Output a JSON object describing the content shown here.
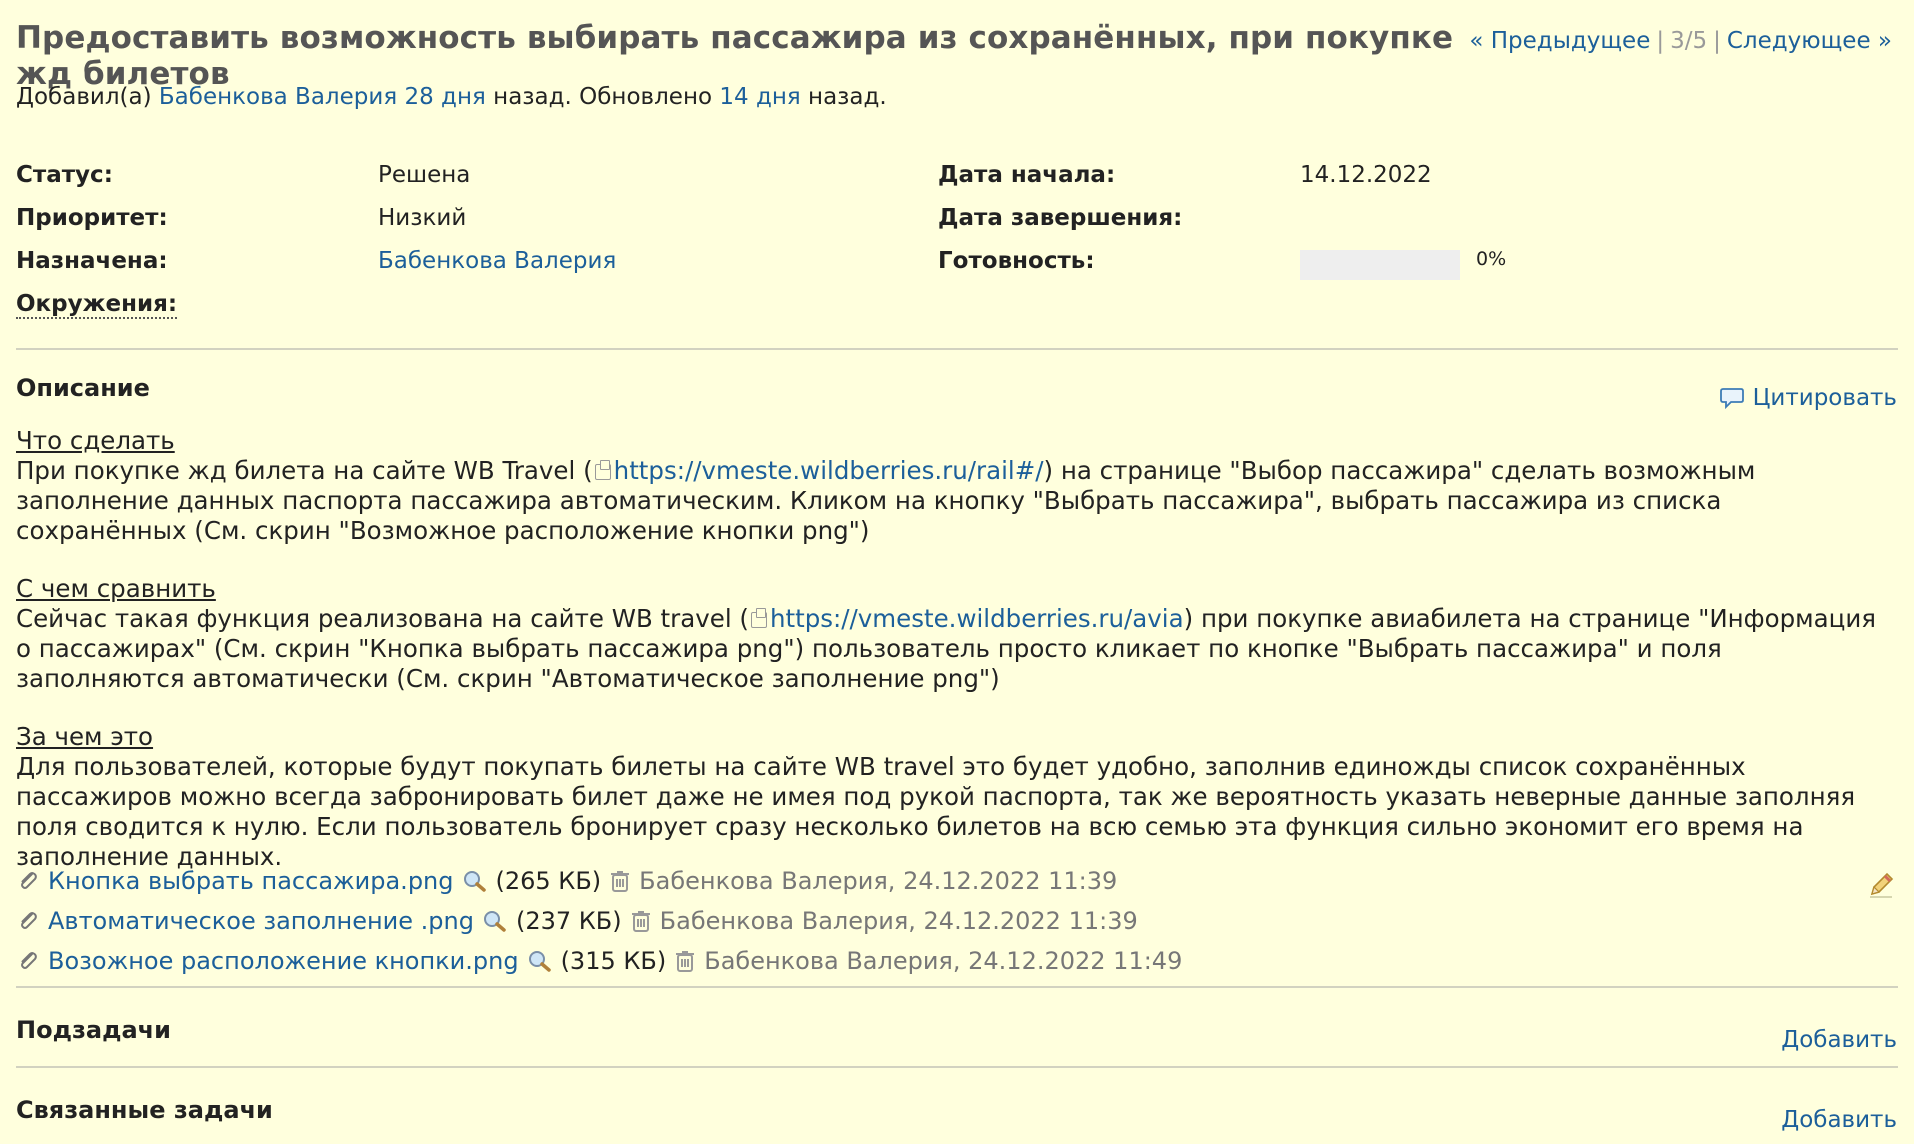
{
  "issue": {
    "title": "Предоставить возможность выбирать пассажира из сохранённых, при покупке жд билетов",
    "nav": {
      "prev": "« Предыдущее",
      "count": "3/5",
      "next": "Следующее »"
    },
    "author_prefix": "Добавил(а)",
    "author_name": "Бабенкова Валерия",
    "added_ago": "28 дня",
    "updated_text": "назад. Обновлено",
    "updated_ago": "14 дня",
    "suffix": "назад."
  },
  "attributes": {
    "status_label": "Статус:",
    "status_value": "Решена",
    "priority_label": "Приоритет:",
    "priority_value": "Низкий",
    "assigned_label": "Назначена:",
    "assigned_value": "Бабенкова Валерия",
    "env_label": "Окружения:",
    "start_label": "Дата начала:",
    "start_value": "14.12.2022",
    "due_label": "Дата завершения:",
    "done_label": "Готовность:",
    "done_value": "0%",
    "done_fraction": 0
  },
  "description": {
    "heading": "Описание",
    "quote_label": "Цитировать",
    "what_title": "Что сделать",
    "what_pre": "При покупке жд билета на сайте WB Travel (",
    "what_link": "https://vmeste.wildberries.ru/rail#/",
    "what_post": ") на странице \"Выбор пассажира\" сделать возможным заполнение данных паспорта пассажира автоматическим. Кликом на кнопку \"Выбрать пассажира\", выбрать пассажира из списка сохранённых (См. скрин \"Возможное расположение кнопки png\")",
    "compare_title": "С чем сравнить",
    "compare_pre": "Сейчас такая функция реализована на сайте WB travel (",
    "compare_link": "https://vmeste.wildberries.ru/avia",
    "compare_post": ") при покупке авиабилета на странице \"Информация о пассажирах\" (См. скрин \"Кнопка выбрать пассажира png\") пользователь просто кликает по кнопке \"Выбрать пассажира\" и поля заполняются автоматически (См. скрин \"Автоматическое заполнение png\")",
    "why_title": "За чем это",
    "why_text": "Для пользователей, которые будут покупать билеты на сайте WB travel это будет удобно, заполнив единожды список сохранённых пассажиров можно всегда забронировать билет даже не имея под рукой паспорта, так же вероятность указать неверные данные заполняя поля сводится к нулю. Если пользователь бронирует сразу несколько билетов на всю семью эта функция сильно экономит его время на заполнение данных."
  },
  "attachments": [
    {
      "name": "Кнопка выбрать пассажира.png",
      "size": "(265 КБ)",
      "meta": "Бабенкова Валерия, 24.12.2022 11:39"
    },
    {
      "name": "Автоматическое заполнение .png",
      "size": "(237 КБ)",
      "meta": "Бабенкова Валерия, 24.12.2022 11:39"
    },
    {
      "name": "Возожное расположение кнопки.png",
      "size": "(315 КБ)",
      "meta": "Бабенкова Валерия, 24.12.2022 11:49"
    }
  ],
  "subtasks": {
    "heading": "Подзадачи",
    "add_label": "Добавить"
  },
  "relations": {
    "heading": "Связанные задачи",
    "add_label": "Добавить"
  },
  "icons": {
    "clip": "paperclip-icon",
    "zoom": "magnifier-icon",
    "delete": "trash-icon",
    "quote": "speech-bubble-icon",
    "edit": "pencil-icon",
    "external": "external-link-icon"
  }
}
